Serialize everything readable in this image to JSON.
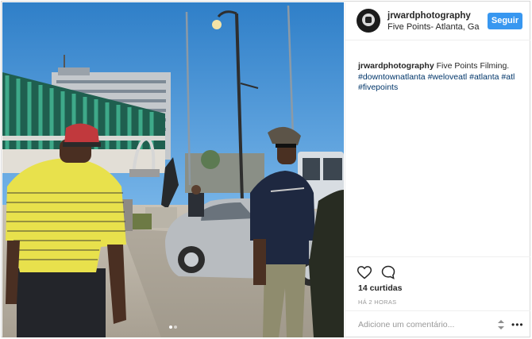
{
  "post": {
    "username": "jrwardphotography",
    "location": "Five Points- Atlanta, Ga",
    "follow_label": "Seguir",
    "caption_text": "Five Points Filming.",
    "hashtags": [
      "#downtownatlanta",
      "#weloveatl",
      "#atlanta",
      "#atl",
      "#fivepoints"
    ],
    "likes": "14 curtidas",
    "time_ago": "HÁ 2 HORAS",
    "comment_placeholder": "Adicione um comentário...",
    "carousel": {
      "count": 2,
      "active_index": 0
    }
  },
  "colors": {
    "accent": "#3897f0",
    "hashtag": "#003569",
    "muted": "#999999",
    "text": "#262626"
  },
  "icons": [
    "avatar-camera-icon",
    "heart-icon",
    "comment-icon",
    "sort-icon",
    "more-options-icon"
  ]
}
